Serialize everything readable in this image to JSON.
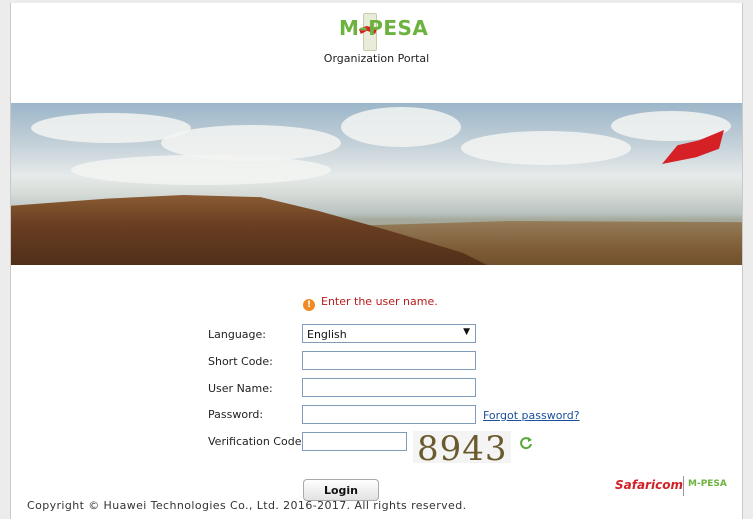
{
  "header": {
    "logo_text": "M-PESA",
    "portal_title": "Organization Portal"
  },
  "error": {
    "message": "Enter the user name."
  },
  "form": {
    "language_label": "Language:",
    "language_value": "English",
    "short_code_label": "Short Code:",
    "user_name_label": "User Name:",
    "password_label": "Password:",
    "forgot_password": "Forgot password?",
    "verification_label": "Verification Code:",
    "captcha_text": "8943",
    "login_label": "Login"
  },
  "footer": {
    "copyright": "Copyright © Huawei Technologies Co., Ltd. 2016-2017. All rights reserved.",
    "brand1": "Safaricom",
    "brand2": "M-PESA"
  },
  "colors": {
    "mpesa_green": "#6cb23e",
    "safaricom_red": "#d12128",
    "error_red": "#b71c1c"
  }
}
